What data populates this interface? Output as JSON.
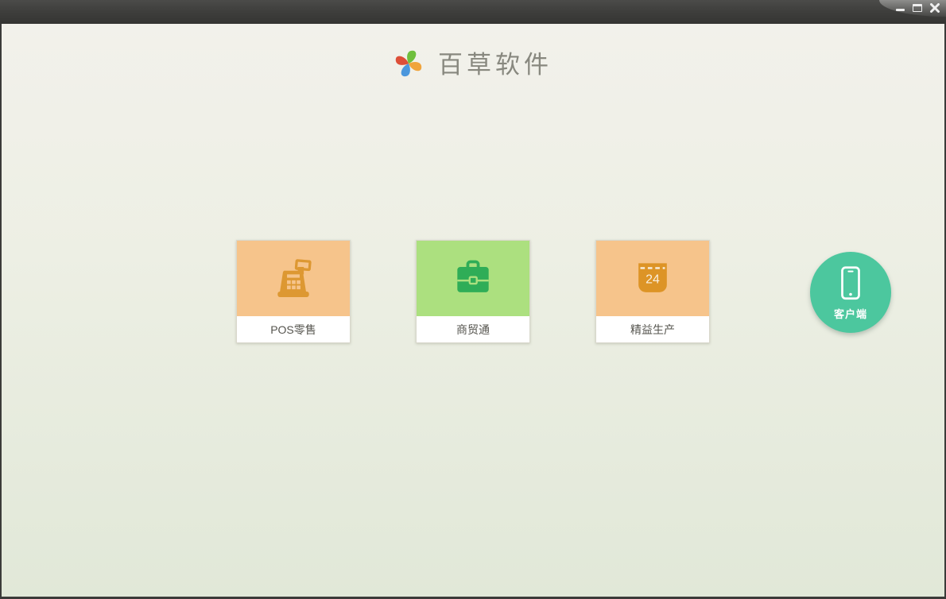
{
  "titlebar": {
    "buttons": [
      {
        "name": "minimize"
      },
      {
        "name": "maximize"
      },
      {
        "name": "close"
      }
    ]
  },
  "header": {
    "app_name": "百草软件",
    "logo_icon": "pinwheel-logo",
    "logo_colors": {
      "top": "#6fbf3d",
      "right": "#f0a43c",
      "bottom": "#4b97dd",
      "left": "#dd4f38"
    }
  },
  "products": [
    {
      "label": "POS零售",
      "icon": "cash-register-icon",
      "card_color": "#f6c48b",
      "icon_color": "#dd9832"
    },
    {
      "label": "商贸通",
      "icon": "briefcase-icon",
      "card_color": "#ace07f",
      "icon_color": "#2fad57"
    },
    {
      "label": "精益生产",
      "icon": "calendar-icon",
      "icon_text": "24",
      "card_color": "#f6c48b",
      "icon_color": "#dd9426"
    }
  ],
  "client_button": {
    "label": "客户端",
    "icon": "smartphone-icon",
    "color": "#4cc79e"
  },
  "colors": {
    "titlebar_top": "#4b4b49",
    "titlebar_bottom": "#343432",
    "frame": "#3b3b39",
    "bg_top": "#f2f1eb",
    "bg_bottom": "#e1e8d8",
    "card_label_text": "#55544e"
  }
}
